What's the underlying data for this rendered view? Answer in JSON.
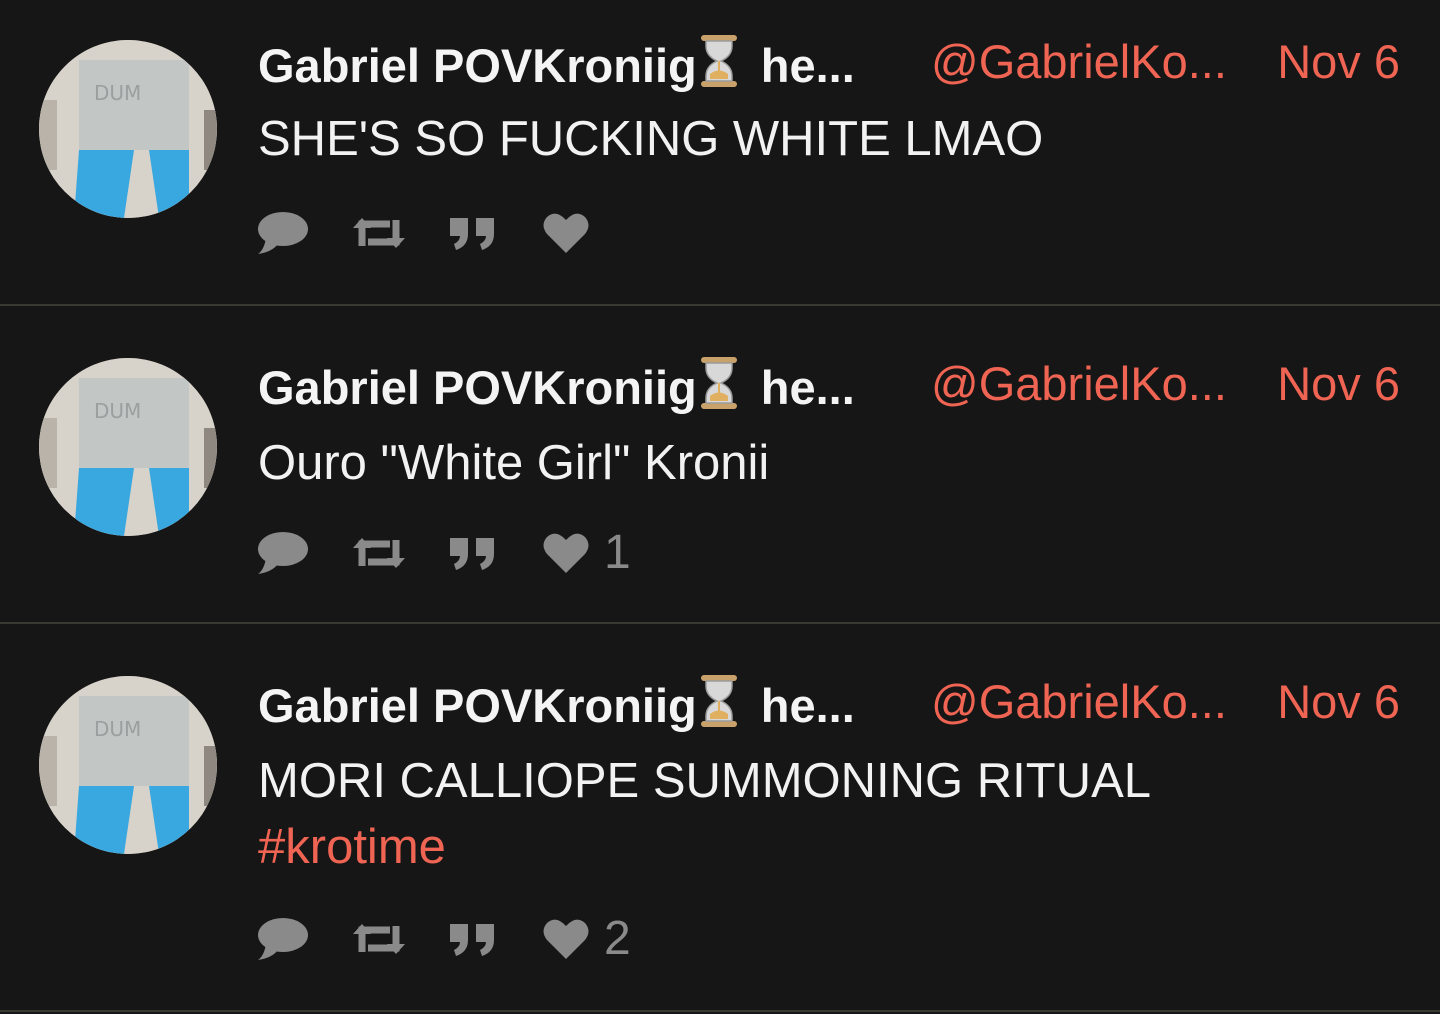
{
  "posts": [
    {
      "author": {
        "name": "Gabriel POVKroniig",
        "name_emoji": "hourglass-emoji",
        "name_tail": "he...",
        "handle": "@GabrielKo...",
        "avatar_text": "DUM"
      },
      "date": "Nov 6",
      "text": "SHE'S SO FUCKING WHITE LMAO",
      "hashtag": "",
      "like_count": ""
    },
    {
      "author": {
        "name": "Gabriel POVKroniig",
        "name_emoji": "hourglass-emoji",
        "name_tail": "he...",
        "handle": "@GabrielKo...",
        "avatar_text": "DUM"
      },
      "date": "Nov 6",
      "text": "Ouro \"White Girl\" Kronii",
      "hashtag": "",
      "like_count": "1"
    },
    {
      "author": {
        "name": "Gabriel POVKroniig",
        "name_emoji": "hourglass-emoji",
        "name_tail": "he...",
        "handle": "@GabrielKo...",
        "avatar_text": "DUM"
      },
      "date": "Nov 6",
      "text": "MORI CALLIOPE SUMMONING RITUAL",
      "hashtag": "#krotime",
      "like_count": "2"
    }
  ],
  "icons": {
    "reply": "speech-bubble-icon",
    "repost": "repost-arrows-icon",
    "quote": "quote-marks-icon",
    "like": "heart-icon"
  },
  "colors": {
    "background": "#161616",
    "accent": "#ef6453",
    "text": "#f2f2f2",
    "icon": "#8a8a8a",
    "separator": "#3a3a33"
  }
}
